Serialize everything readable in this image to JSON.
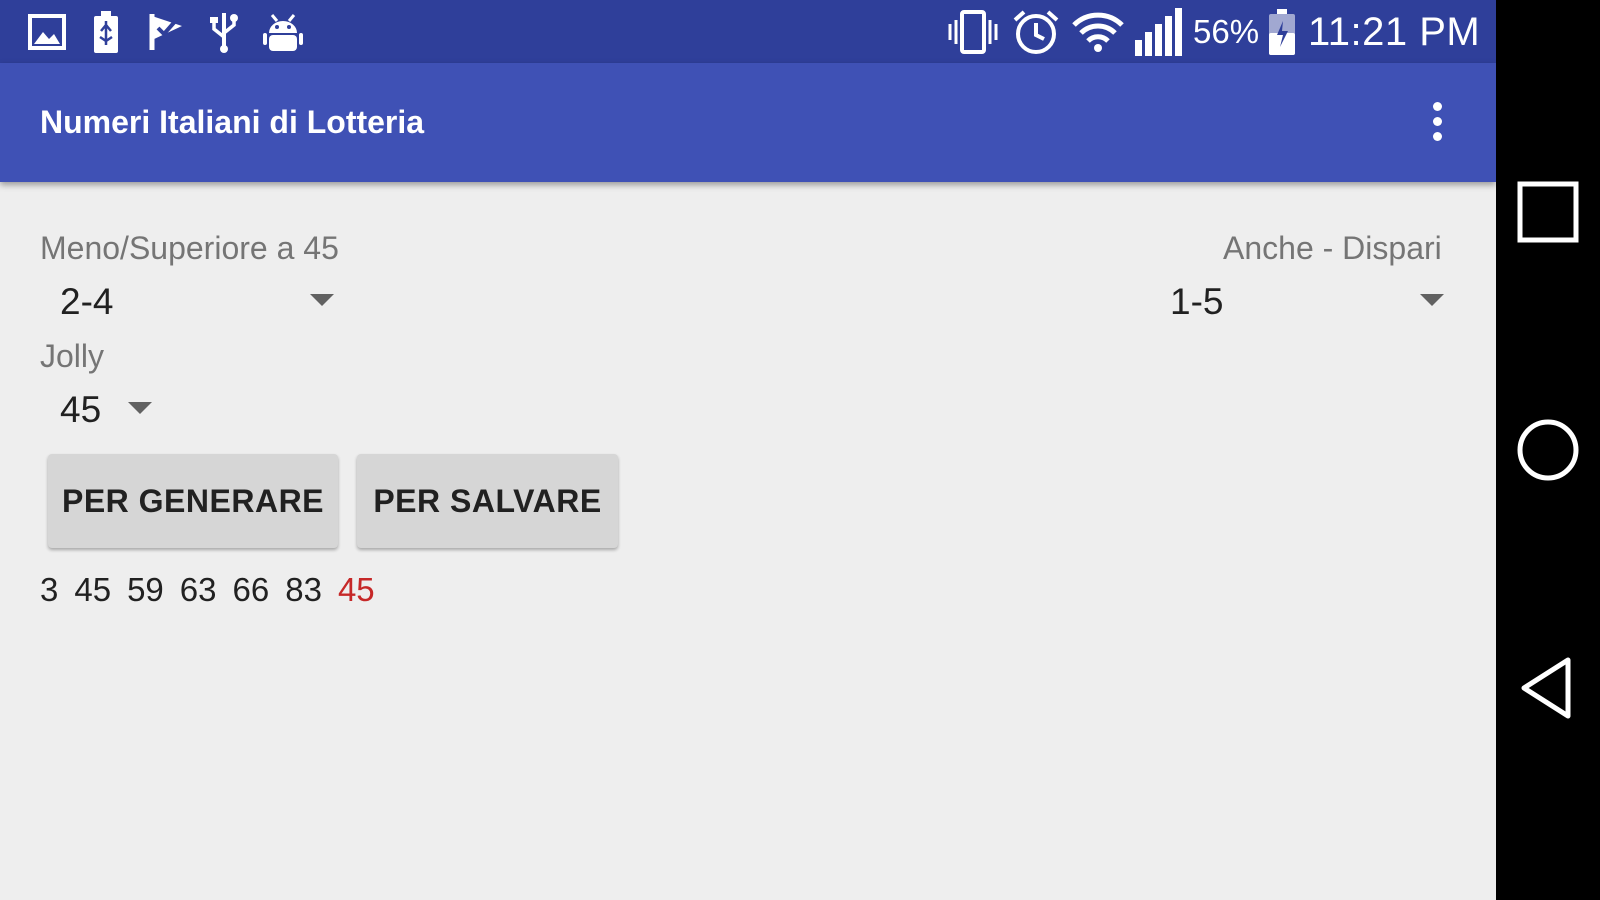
{
  "status_bar": {
    "icons_left": [
      "image-icon",
      "battery-usb-icon",
      "flag-check-icon",
      "usb-icon",
      "android-debug-icon"
    ],
    "icons_right": [
      "vibrate-icon",
      "alarm-icon",
      "wifi-icon",
      "signal-icon",
      "battery-icon"
    ],
    "battery_percent": "56%",
    "time": "11:21 PM"
  },
  "app_bar": {
    "title": "Numeri Italiani di Lotteria",
    "menu_icon": "overflow-menu-icon"
  },
  "form": {
    "low_high": {
      "label": "Meno/Superiore a 45",
      "value": "2-4"
    },
    "even_odd": {
      "label": "Anche - Dispari",
      "value": "1-5"
    },
    "jolly": {
      "label": "Jolly",
      "value": "45"
    }
  },
  "buttons": {
    "generate": "PER GENERARE",
    "save": "PER SALVARE"
  },
  "result": {
    "numbers": [
      "3",
      "45",
      "59",
      "63",
      "66",
      "83"
    ],
    "jolly": "45",
    "jolly_color": "#c62828"
  },
  "nav_bar": {
    "buttons": [
      "recents-icon",
      "home-icon",
      "back-icon"
    ]
  },
  "colors": {
    "status_bar": "#2f3f9a",
    "app_bar": "#3f51b5",
    "background": "#eeeeee",
    "button": "#d6d6d6"
  }
}
